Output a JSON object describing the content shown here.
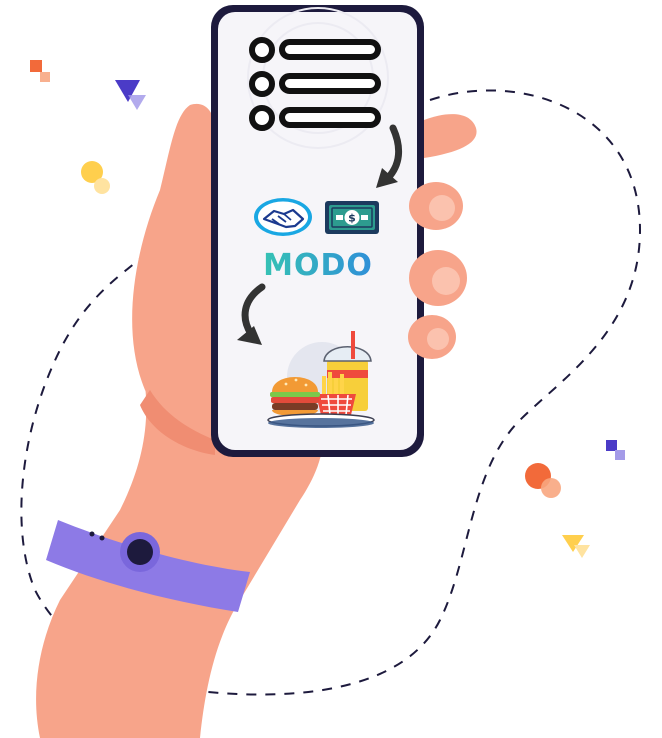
{
  "brand": {
    "modo_label": "MODO",
    "modo_gradient": [
      "#36c2b4",
      "#2f8fd8"
    ]
  },
  "colors": {
    "skin": "#f7a48a",
    "skin_shadow": "#f08d72",
    "bracelet": "#8d7ae6",
    "phone_frame": "#1d1a3d",
    "screen": "#f6f5f9",
    "dashed_path": "#1d1a3d",
    "accent_orange": "#f26a3a",
    "accent_yellow": "#ffcf4d",
    "accent_purple": "#4b3bc7"
  },
  "icons": {
    "menu_list": "list-icon",
    "handshake": "handshake-icon",
    "cash": "dollar-bill-icon",
    "food": "burger-fries-drink-icon",
    "arrow": "curved-arrow-icon"
  },
  "list_items": 3
}
